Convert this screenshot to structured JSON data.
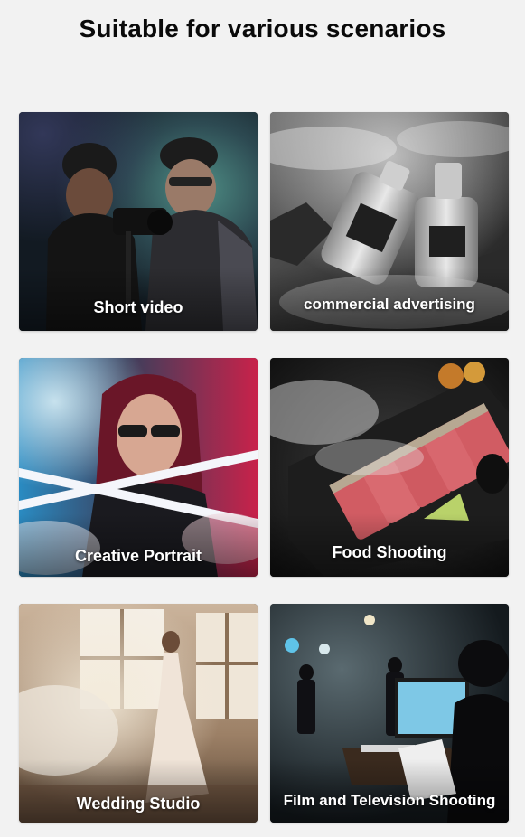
{
  "page": {
    "title": "Suitable for various scenarios"
  },
  "scenarios": [
    {
      "label": "Short video",
      "icon": "videographers-photo"
    },
    {
      "label": "commercial advertising",
      "icon": "perfume-bottles-photo"
    },
    {
      "label": "Creative Portrait",
      "icon": "portrait-with-light-sticks-photo"
    },
    {
      "label": "Food Shooting",
      "icon": "seared-tuna-plate-photo"
    },
    {
      "label": "Wedding Studio",
      "icon": "bride-in-studio-photo"
    },
    {
      "label": "Film and Television Shooting",
      "icon": "film-set-photo"
    }
  ],
  "colors": {
    "background": "#f2f2f2",
    "title_text": "#0a0a0a",
    "label_text": "#ffffff"
  }
}
